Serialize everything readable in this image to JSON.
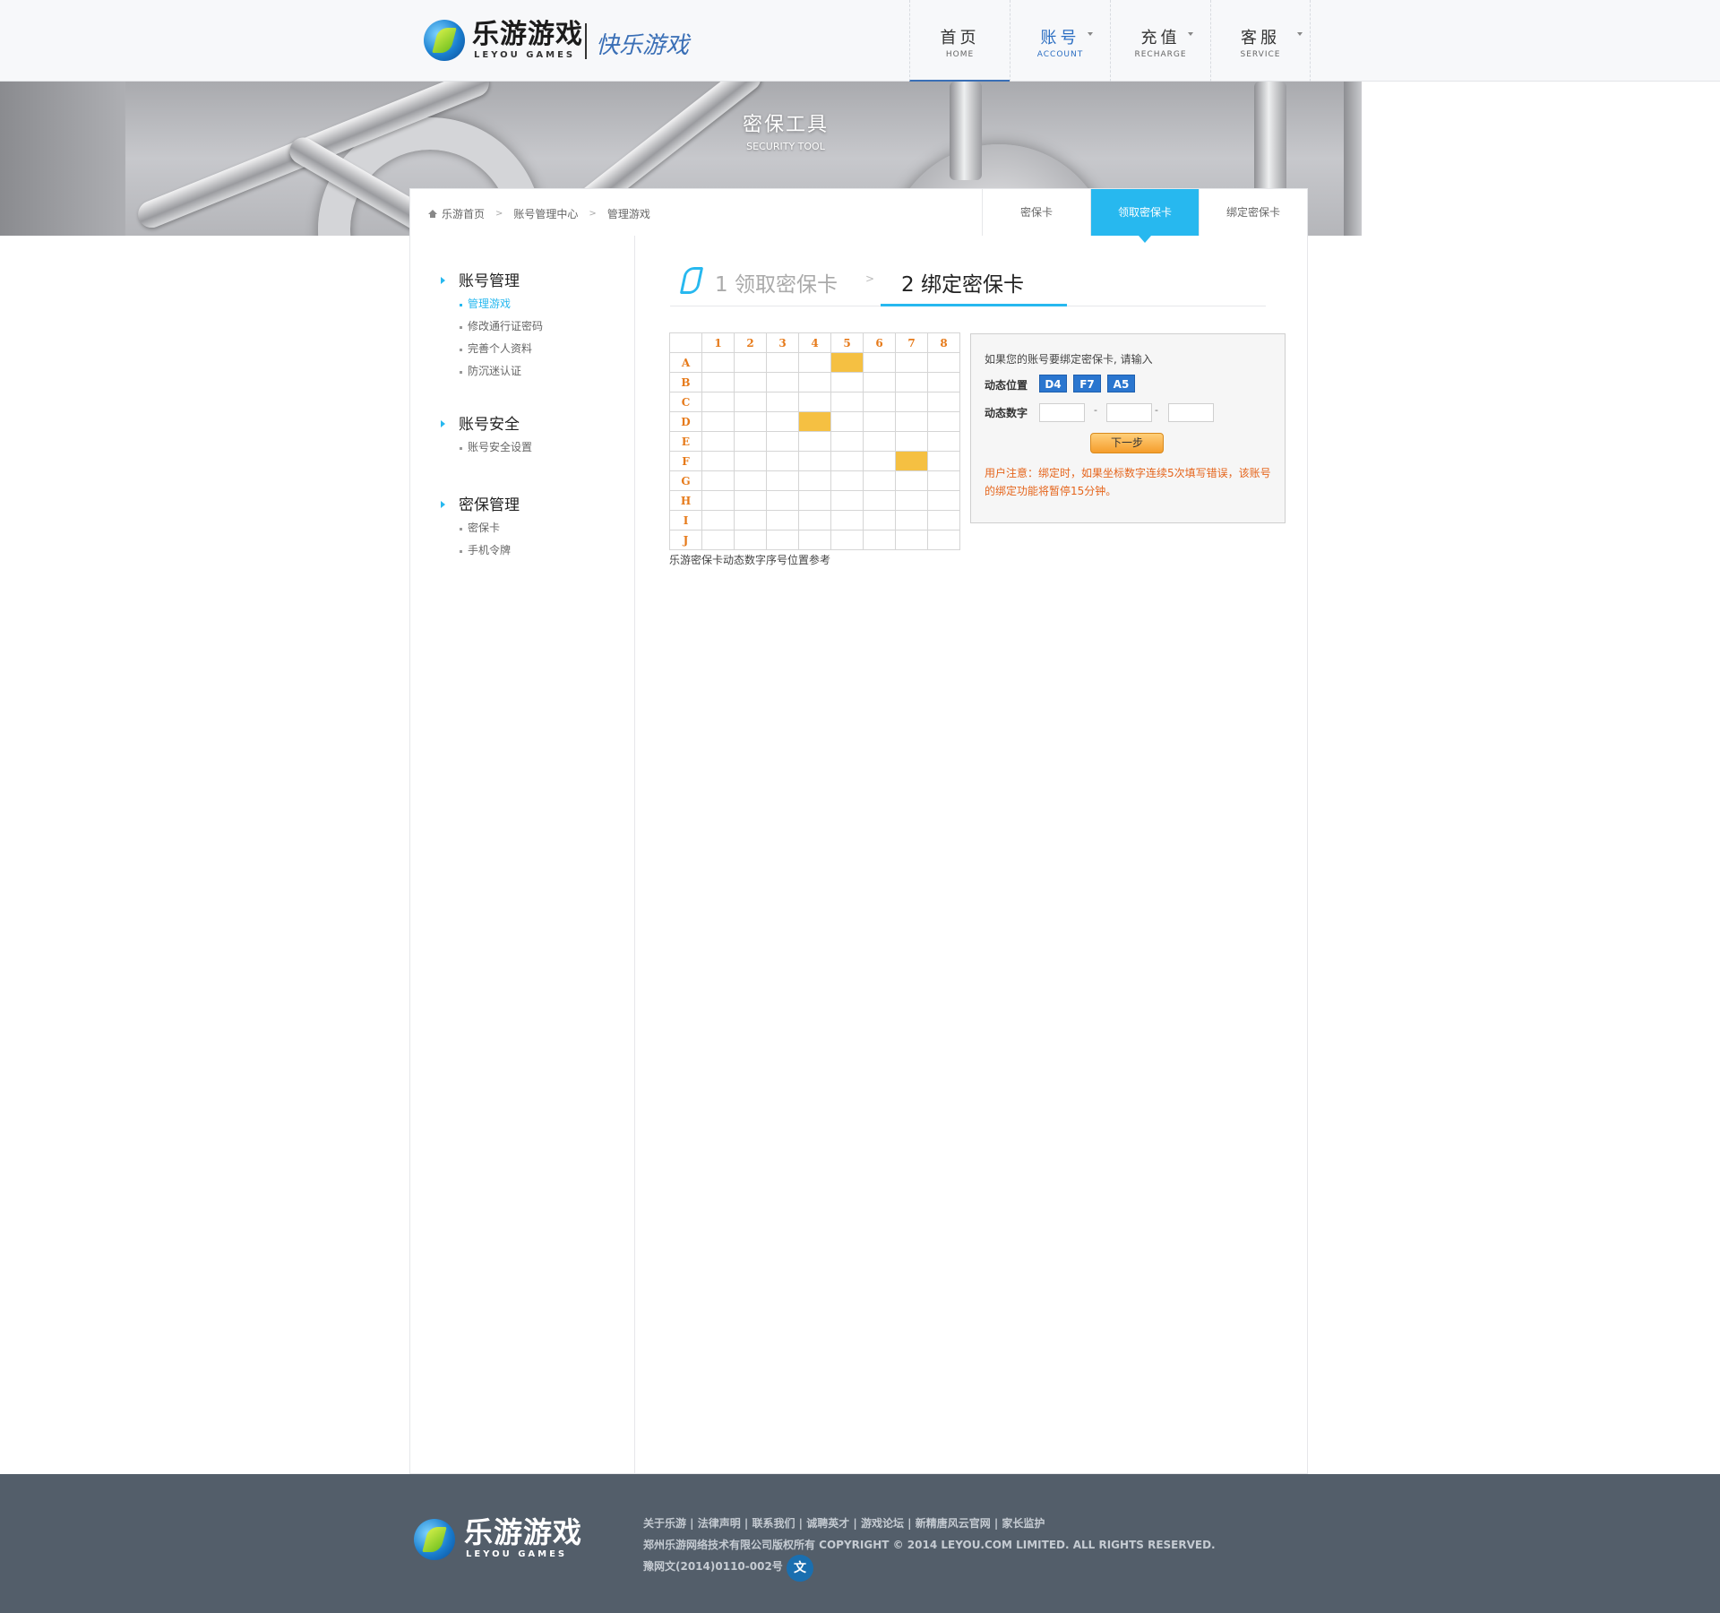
{
  "header": {
    "logo_cn": "乐游游戏",
    "logo_en": "LEYOU GAMES",
    "slogan": "快乐游戏",
    "nav": [
      {
        "cn": "首页",
        "en": "HOME"
      },
      {
        "cn": "账号",
        "en": "ACCOUNT"
      },
      {
        "cn": "充值",
        "en": "RECHARGE"
      },
      {
        "cn": "客服",
        "en": "SERVICE"
      }
    ]
  },
  "banner": {
    "title": "密保工具",
    "subtitle": "SECURITY TOOL"
  },
  "breadcrumb": [
    "乐游首页",
    "账号管理中心",
    "管理游戏"
  ],
  "tabs": [
    "密保卡",
    "领取密保卡",
    "绑定密保卡"
  ],
  "sidebar": [
    {
      "title": "账号管理",
      "items": [
        "管理游戏",
        "修改通行证密码",
        "完善个人资料",
        "防沉迷认证"
      ]
    },
    {
      "title": "账号安全",
      "items": [
        "账号安全设置"
      ]
    },
    {
      "title": "密保管理",
      "items": [
        "密保卡",
        "手机令牌"
      ]
    }
  ],
  "steps": {
    "step1": "1 领取密保卡",
    "step2": "2 绑定密保卡"
  },
  "grid": {
    "columns": [
      "1",
      "2",
      "3",
      "4",
      "5",
      "6",
      "7",
      "8"
    ],
    "rows": [
      "A",
      "B",
      "C",
      "D",
      "E",
      "F",
      "G",
      "H",
      "I",
      "J"
    ],
    "highlighted": [
      "A5",
      "D4",
      "F7"
    ],
    "caption": "乐游密保卡动态数字序号位置参考"
  },
  "bind": {
    "intro": "如果您的账号要绑定密保卡, 请输入",
    "position_label": "动态位置",
    "positions": [
      "D4",
      "F7",
      "A5"
    ],
    "digits_label": "动态数字",
    "dash": "-",
    "next_button": "下一步",
    "notice": "用户注意：绑定时，如果坐标数字连续5次填写错误，该账号的绑定功能将暂停15分钟。"
  },
  "footer": {
    "logo_cn": "乐游游戏",
    "logo_en": "LEYOU GAMES",
    "links": "关于乐游 | 法律声明 | 联系我们 | 诚聘英才 | 游戏论坛 | 新精唐风云官网 | 家长监护",
    "copyright": "郑州乐游网络技术有限公司版权所有 COPYRIGHT © 2014 LEYOU.COM LIMITED. ALL RIGHTS RESERVED.",
    "icp": "豫网文(2014)0110-002号",
    "badge": "文"
  },
  "colors": {
    "accent": "#27b8ef",
    "highlight": "#f5c042",
    "footer_bg": "#535e6a",
    "badge_blue": "#2a76cf",
    "notice_orange": "#e5651c"
  }
}
